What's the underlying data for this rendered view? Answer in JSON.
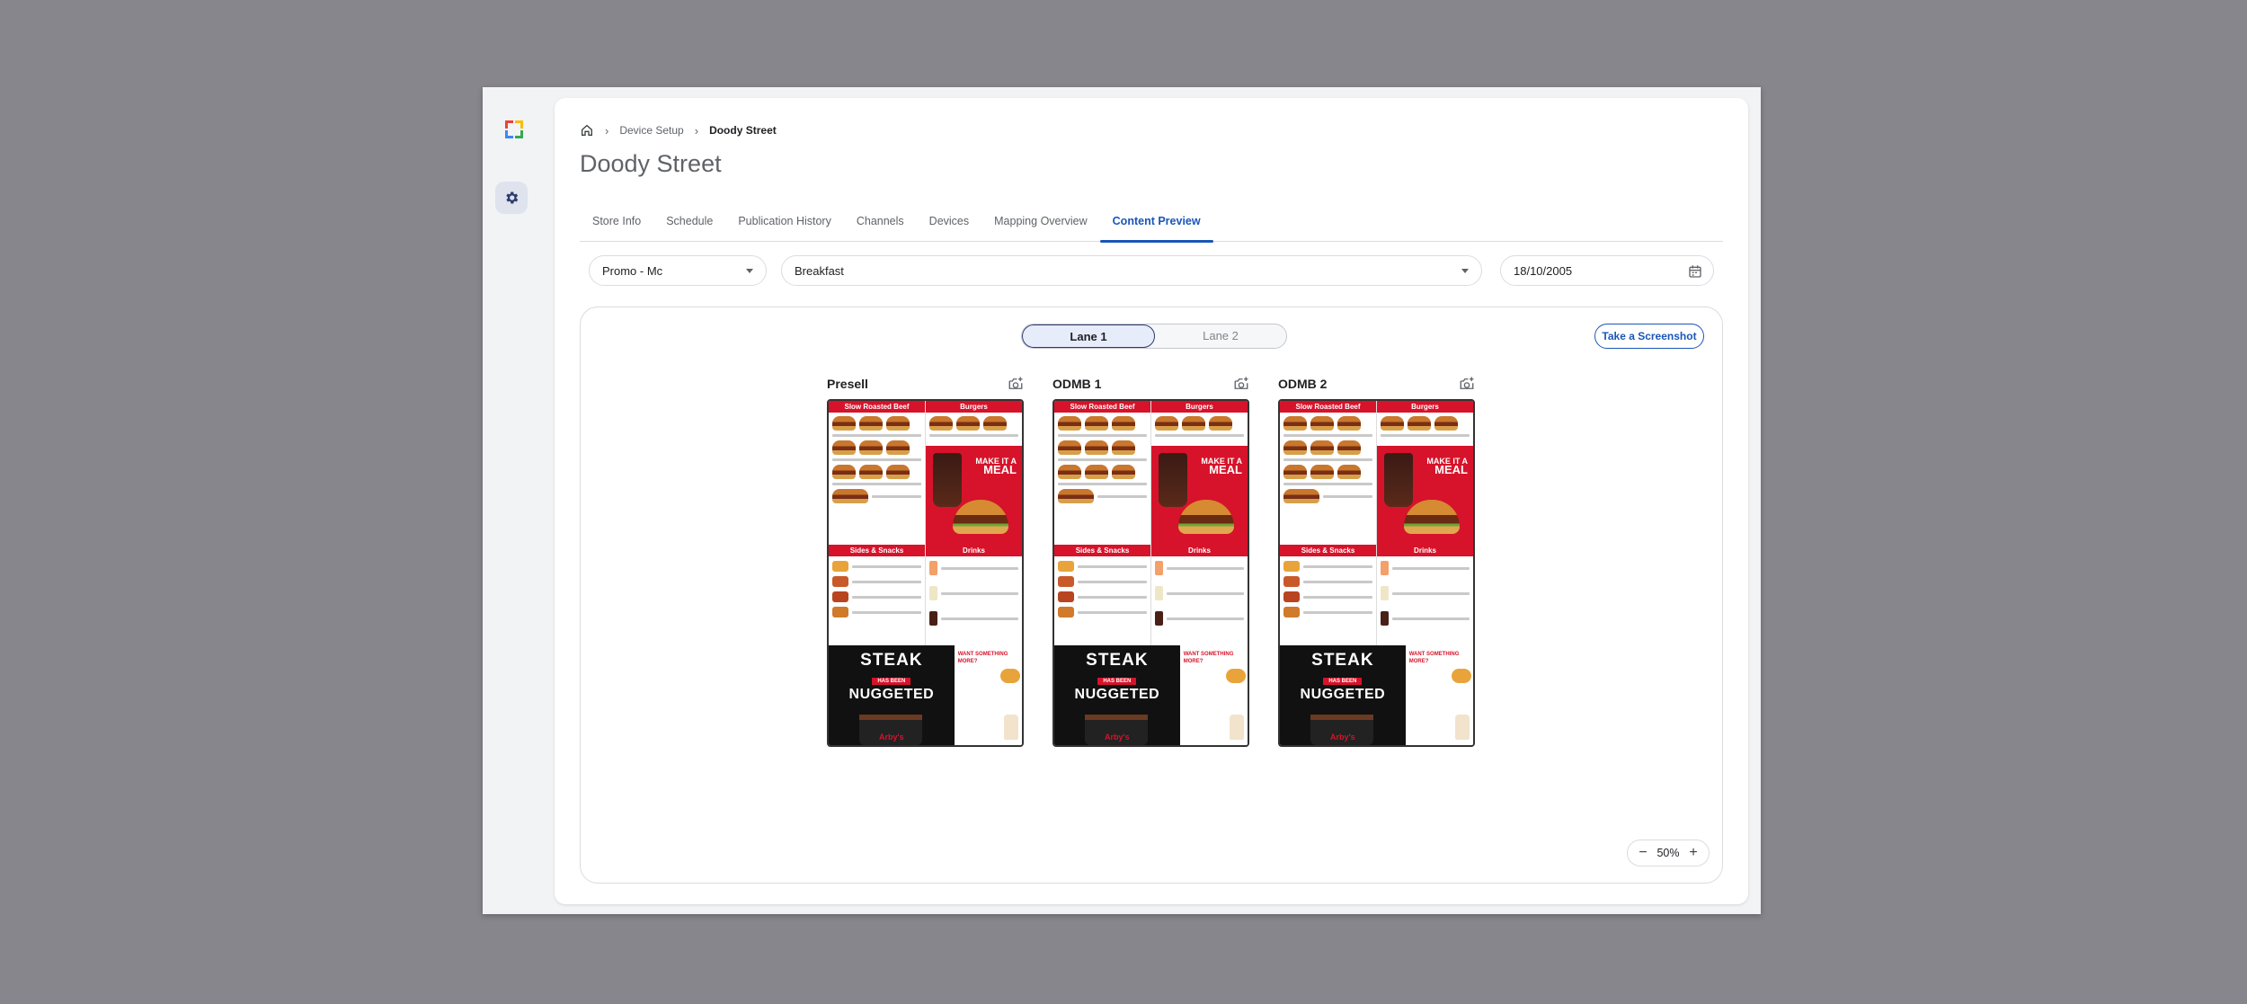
{
  "breadcrumb": {
    "parent": "Device Setup",
    "current": "Doody Street"
  },
  "page_title": "Doody Street",
  "tabs": [
    {
      "label": "Store Info"
    },
    {
      "label": "Schedule"
    },
    {
      "label": "Publication History"
    },
    {
      "label": "Channels"
    },
    {
      "label": "Devices"
    },
    {
      "label": "Mapping Overview"
    },
    {
      "label": "Content Preview",
      "active": true
    }
  ],
  "filters": {
    "promo": "Promo - Mc",
    "daypart": "Breakfast",
    "date": "18/10/2005"
  },
  "lanes": [
    {
      "label": "Lane 1",
      "active": true
    },
    {
      "label": "Lane 2",
      "active": false
    }
  ],
  "screenshot_button": "Take a Screenshot",
  "screens": [
    {
      "name": "Presell"
    },
    {
      "name": "ODMB 1"
    },
    {
      "name": "ODMB 2"
    }
  ],
  "menu": {
    "slow_roasted": "Slow Roasted Beef",
    "burgers": "Burgers",
    "sides": "Sides & Snacks",
    "drinks": "Drinks",
    "make_it_a": "MAKE IT A",
    "meal": "MEAL",
    "steak": "STEAK",
    "has_been": "HAS BEEN",
    "nuggeted": "NUGGETED",
    "brand": "Arby's",
    "want_more": "WANT SOMETHING MORE?"
  },
  "zoom": {
    "level": "50%"
  },
  "colors": {
    "accent": "#1a56b8",
    "menu_red": "#d6132a"
  }
}
